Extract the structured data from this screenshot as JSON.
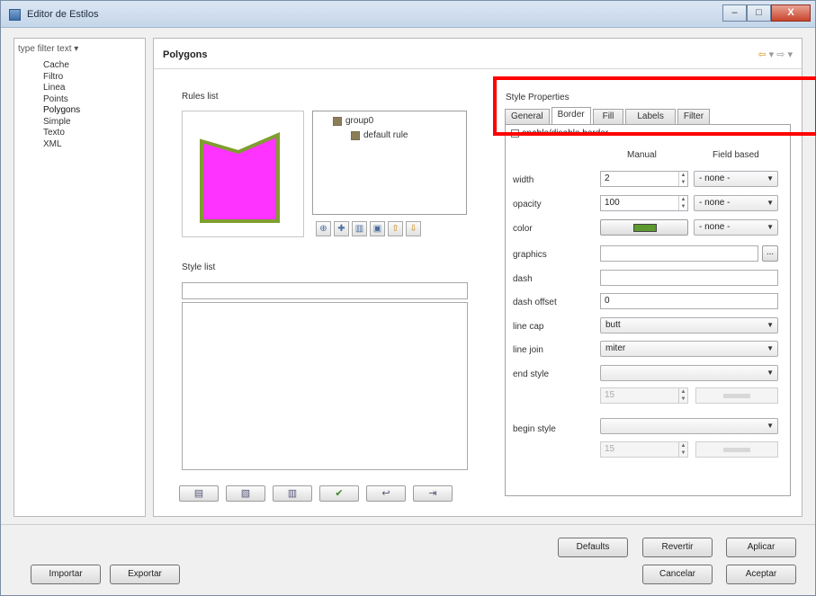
{
  "window": {
    "title": "Editor de Estilos",
    "minimize": "–",
    "maximize": "□",
    "close": "X"
  },
  "left_panel": {
    "type_filter": "type filter text ▾",
    "categories": [
      "Cache",
      "Filtro",
      "Linea",
      "Points",
      "Polygons",
      "Simple",
      "Texto",
      "XML"
    ],
    "selected": "Polygons"
  },
  "page": {
    "title": "Polygons",
    "rules_list_label": "Rules list",
    "style_list_label": "Style list",
    "tree": {
      "group": "group0",
      "rule": "default rule"
    },
    "rule_toolbar_icons": [
      "add-rule-icon",
      "add-group-icon",
      "delete-icon",
      "copy-icon",
      "move-up-icon",
      "move-down-icon"
    ],
    "style_toolbar_icons": [
      "save-icon",
      "open-icon",
      "delete-icon",
      "apply-check-icon",
      "undo-icon",
      "export-icon"
    ],
    "style_list_input": "",
    "preview_colors": {
      "fill": "#ff33ff",
      "stroke": "#7f9e2f"
    }
  },
  "style_properties": {
    "title": "Style Properties",
    "tabs": [
      "General",
      "Border",
      "Fill",
      "Labels",
      "Filter"
    ],
    "active_tab": "Border",
    "enable_border": "enable/disable border",
    "col_manual": "Manual",
    "col_field": "Field based",
    "width": {
      "label": "width",
      "value": "2",
      "field": "- none -"
    },
    "opacity": {
      "label": "opacity",
      "value": "100",
      "field": "- none -"
    },
    "color": {
      "label": "color",
      "value_color": "#5e9a2f",
      "field": "- none -"
    },
    "graphics": {
      "label": "graphics",
      "button": "..."
    },
    "dash": {
      "label": "dash",
      "value": ""
    },
    "dash_offset": {
      "label": "dash offset",
      "value": "0"
    },
    "line_cap": {
      "label": "line cap",
      "value": "butt"
    },
    "line_join": {
      "label": "line join",
      "value": "miter"
    },
    "end_style": {
      "label": "end style",
      "value": "",
      "size": "15"
    },
    "begin_style": {
      "label": "begin style",
      "value": "",
      "size": "15"
    }
  },
  "buttons": {
    "defaults": "Defaults",
    "revert": "Revertir",
    "apply": "Aplicar",
    "cancel": "Cancelar",
    "accept": "Aceptar",
    "import": "Importar",
    "export": "Exportar"
  },
  "highlight_color": "#ff0000"
}
